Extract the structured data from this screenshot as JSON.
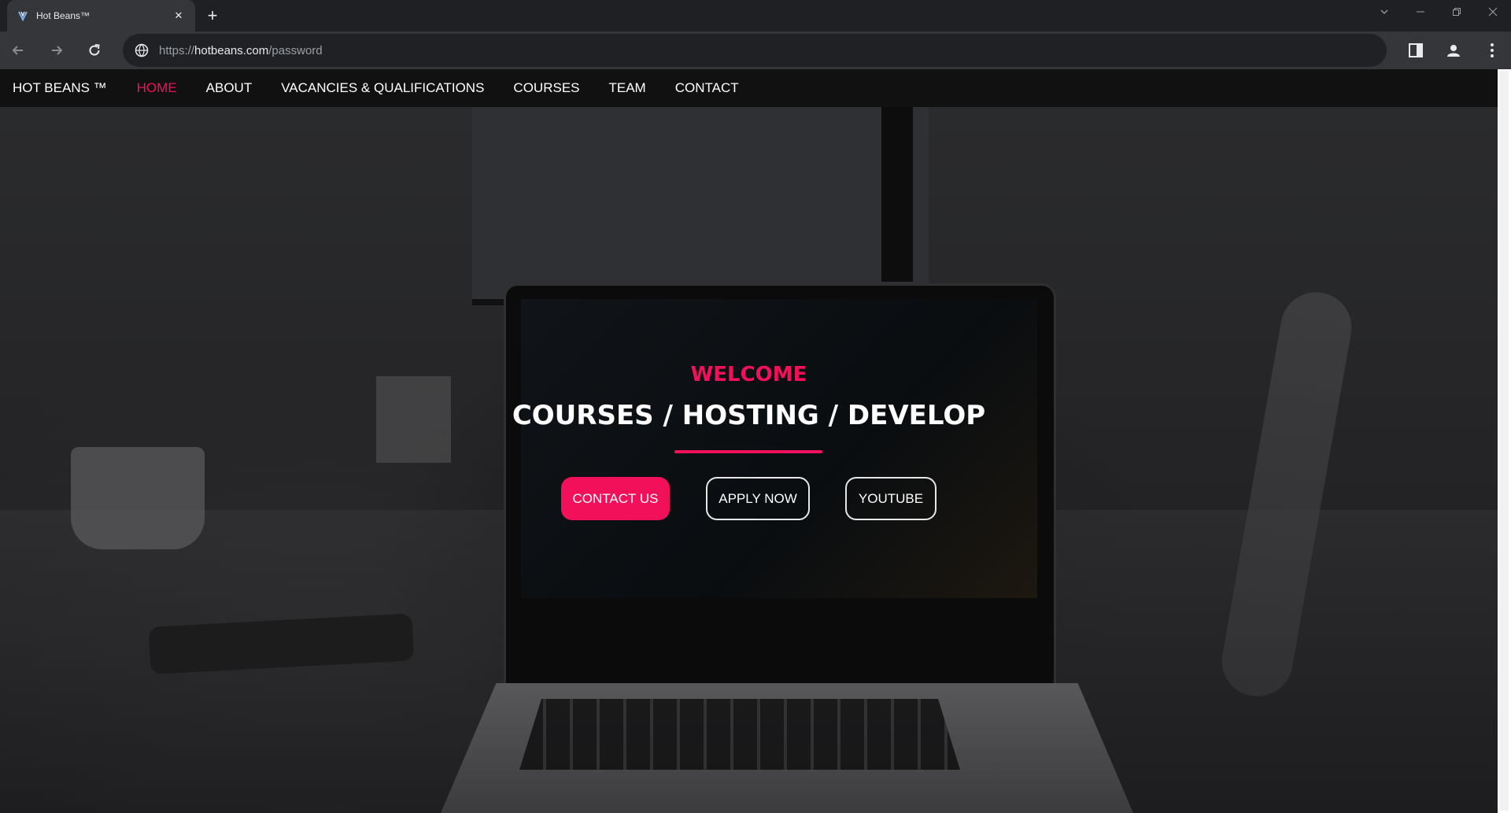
{
  "browser": {
    "tab_title": "Hot Beans™",
    "url_scheme": "https://",
    "url_host": "hotbeans.com",
    "url_path": "/password"
  },
  "site": {
    "brand": "HOT BEANS ™",
    "nav": [
      {
        "label": "HOME",
        "active": true
      },
      {
        "label": "ABOUT"
      },
      {
        "label": "VACANCIES & QUALIFICATIONS"
      },
      {
        "label": "COURSES"
      },
      {
        "label": "TEAM"
      },
      {
        "label": "CONTACT"
      }
    ]
  },
  "hero": {
    "welcome": "WELCOME",
    "headline": "COURSES / HOSTING / DEVELOP",
    "buttons": {
      "contact": "CONTACT US",
      "apply": "APPLY NOW",
      "youtube": "YOUTUBE"
    }
  },
  "colors": {
    "accent": "#f2105a",
    "nav_bg": "#111111",
    "chrome_bg": "#35363a"
  }
}
